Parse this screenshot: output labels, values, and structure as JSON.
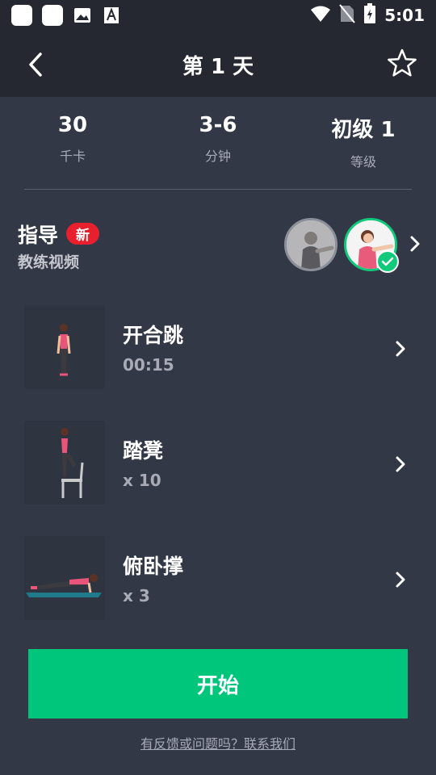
{
  "status_bar": {
    "time": "5:01",
    "left_icons": [
      "app-icon",
      "app-icon",
      "image-icon",
      "font-icon"
    ],
    "right_icons": [
      "wifi-icon",
      "no-sim-icon",
      "battery-charging-icon"
    ]
  },
  "header": {
    "title": "第 1 天",
    "back_icon": "chevron-left-icon",
    "favorite_icon": "star-icon"
  },
  "stats": [
    {
      "value": "30",
      "label": "千卡"
    },
    {
      "value": "3-6",
      "label": "分钟"
    },
    {
      "value": "初级 1",
      "label": "等级"
    }
  ],
  "guide": {
    "title": "指导",
    "badge": "新",
    "subtitle": "教练视频"
  },
  "exercises": [
    {
      "name": "开合跳",
      "detail": "00:15"
    },
    {
      "name": "踏凳",
      "detail": "x 10"
    },
    {
      "name": "俯卧撑",
      "detail": "x 3"
    }
  ],
  "start_button": "开始",
  "feedback_link": "有反馈或问题吗？联系我们",
  "colors": {
    "background": "#333846",
    "header": "#252831",
    "accent_green": "#00c67b",
    "badge_red": "#e8202d"
  }
}
